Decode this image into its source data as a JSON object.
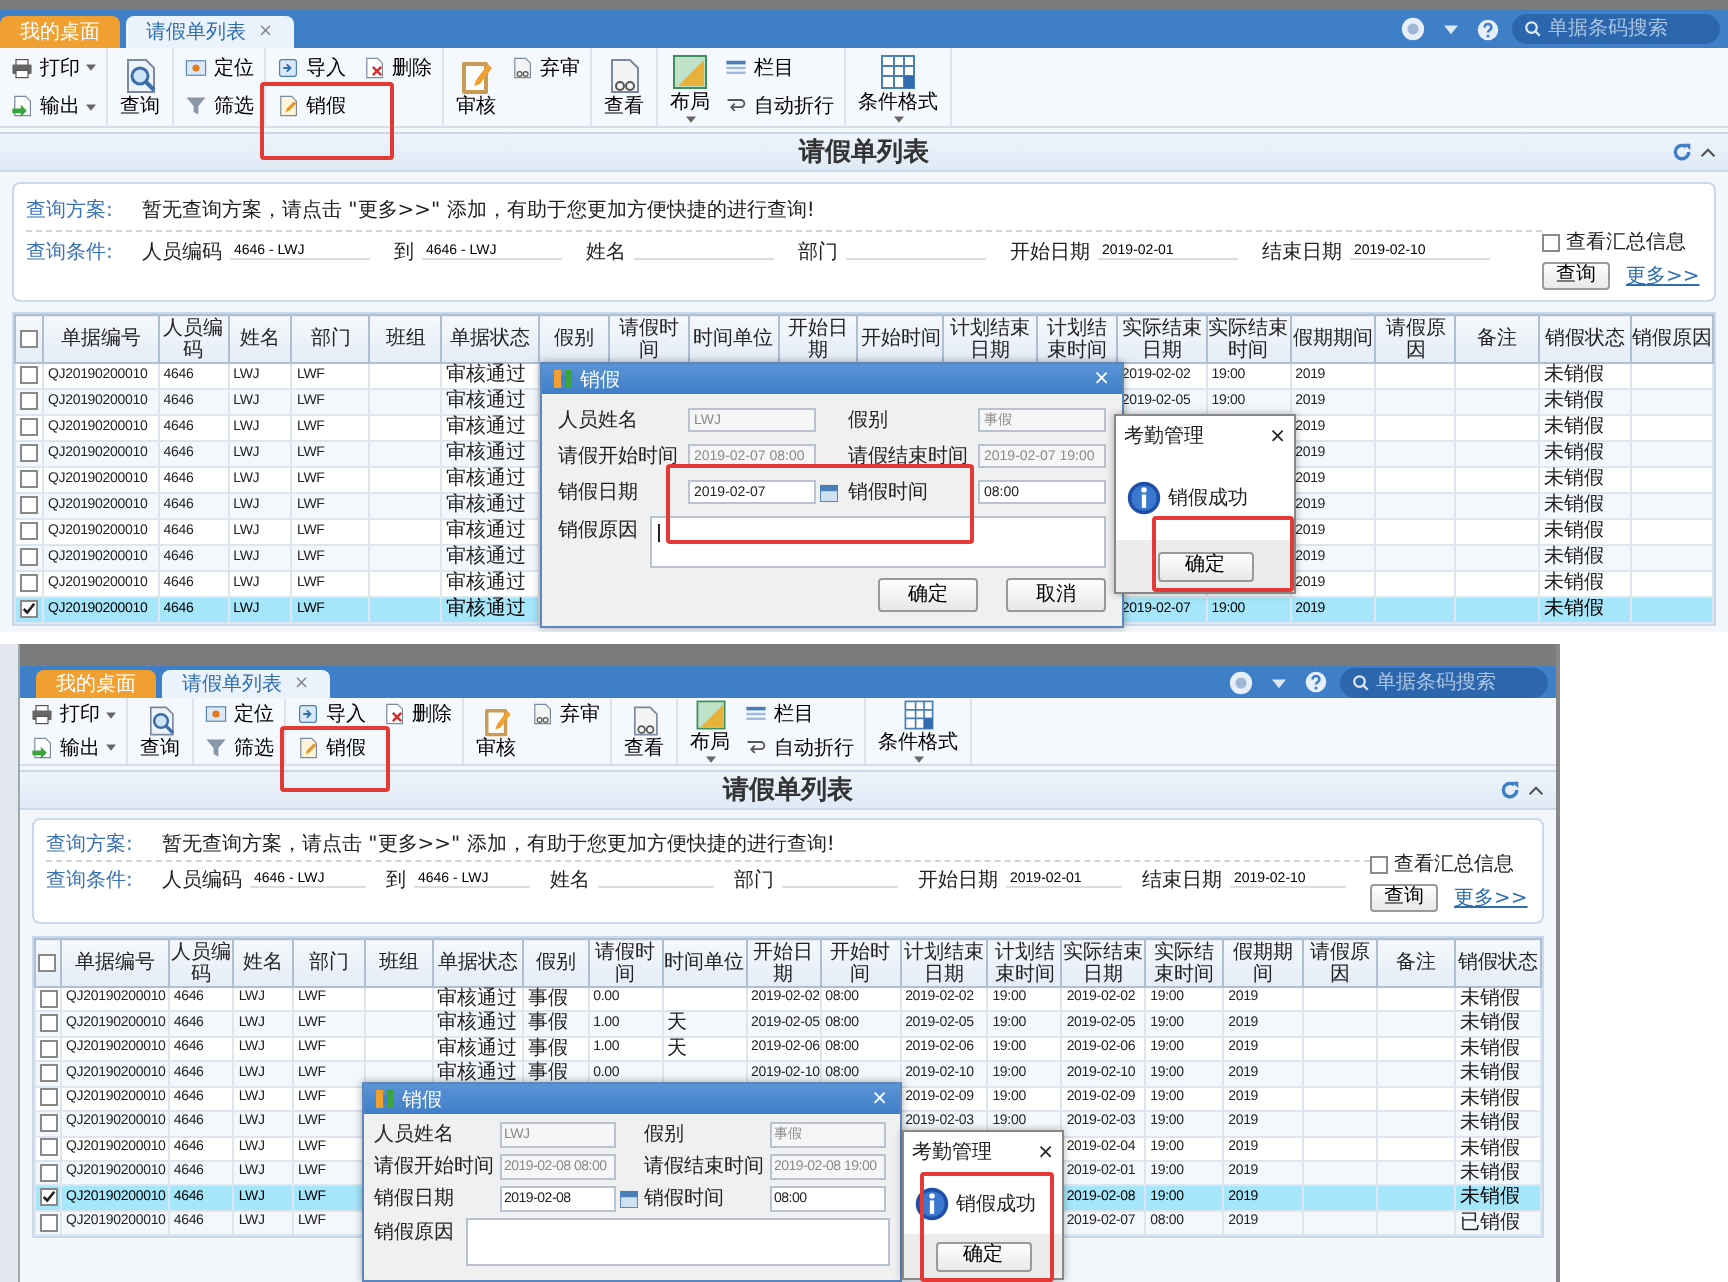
{
  "shots": [
    {
      "behind_window": false,
      "tabs": [
        {
          "label": "我的桌面",
          "kind": "home",
          "selected": false
        },
        {
          "label": "请假单列表",
          "kind": "page",
          "selected": true,
          "close": "×"
        }
      ],
      "search_placeholder": "单据条码搜索",
      "toolbar": [
        {
          "items": [
            {
              "label": "打印",
              "kind": "small",
              "dropdown": true,
              "highlighted": false
            },
            {
              "label": "输出",
              "kind": "small",
              "dropdown": true,
              "highlighted": false
            }
          ]
        },
        {
          "items": [
            {
              "label": "查询",
              "kind": "large",
              "highlighted": false
            }
          ]
        },
        {
          "items": [
            {
              "label": "定位",
              "kind": "small",
              "highlighted": false
            },
            {
              "label": "筛选",
              "kind": "small",
              "highlighted": false
            }
          ]
        },
        {
          "items": [
            {
              "label": "导入",
              "kind": "small",
              "highlighted": false
            },
            {
              "label": "销假",
              "kind": "small",
              "highlighted": true
            },
            {
              "label": "删除",
              "kind": "small",
              "highlighted": false
            }
          ]
        },
        {
          "items": [
            {
              "label": "审核",
              "kind": "large",
              "highlighted": false
            },
            {
              "label": "弃审",
              "kind": "small",
              "highlighted": false
            }
          ]
        },
        {
          "items": [
            {
              "label": "查看",
              "kind": "large",
              "highlighted": false
            }
          ]
        },
        {
          "items": [
            {
              "label": "布局",
              "kind": "large",
              "dropdown": true,
              "highlighted": false
            },
            {
              "label": "栏目",
              "kind": "small",
              "highlighted": false
            },
            {
              "label": "自动折行",
              "kind": "small",
              "highlighted": false
            }
          ]
        },
        {
          "items": [
            {
              "label": "条件格式",
              "kind": "large",
              "dropdown": true,
              "highlighted": false
            }
          ]
        }
      ],
      "page_title": "请假单列表",
      "query": {
        "scheme_label": "查询方案:",
        "scheme_text": "暂无查询方案，请点击 \"更多>>\" 添加，有助于您更加方便快捷的进行查询!",
        "condition_label": "查询条件:",
        "fields": [
          {
            "label": "人员编码",
            "value": "4646 - LWJ"
          },
          {
            "label": "到",
            "value": "4646 - LWJ"
          },
          {
            "label": "姓名"
          },
          {
            "label": "部门"
          },
          {
            "label": "开始日期",
            "value": "2019-02-01"
          },
          {
            "label": "结束日期",
            "value": "2019-02-10"
          }
        ],
        "summary": {
          "label": "查看汇总信息",
          "checked": false
        },
        "search_button": "查询",
        "more_link": "更多>>"
      },
      "table": {
        "header_checked": false,
        "columns": [
          "单据编号",
          "人员编码",
          "姓名",
          "部门",
          "班组",
          "单据状态",
          "假别",
          "请假时间",
          "时间单位",
          "开始日期",
          "开始时间",
          "计划结束日期",
          "计划结束时间",
          "实际结束日期",
          "实际结束时间",
          "假期期间",
          "请假原因",
          "备注",
          "销假状态",
          "销假原因"
        ],
        "rows": [
          {
            "checked": false,
            "selected": false,
            "cells": [
              "QJ20190200010",
              "4646",
              "LWJ",
              "LWF",
              null,
              "审核通过",
              null,
              null,
              null,
              null,
              null,
              null,
              null,
              "2019-02-02",
              "19:00",
              "2019",
              null,
              null,
              "未销假"
            ]
          },
          {
            "checked": false,
            "selected": false,
            "cells": [
              "QJ20190200010",
              "4646",
              "LWJ",
              "LWF",
              null,
              "审核通过",
              null,
              null,
              null,
              null,
              null,
              null,
              null,
              "2019-02-05",
              "19:00",
              "2019",
              null,
              null,
              "未销假"
            ]
          },
          {
            "checked": false,
            "selected": false,
            "cells": [
              "QJ20190200010",
              "4646",
              "LWJ",
              "LWF",
              null,
              "审核通过",
              null,
              null,
              null,
              null,
              null,
              null,
              null,
              null,
              null,
              "2019",
              null,
              null,
              "未销假"
            ]
          },
          {
            "checked": false,
            "selected": false,
            "cells": [
              "QJ20190200010",
              "4646",
              "LWJ",
              "LWF",
              null,
              "审核通过",
              null,
              null,
              null,
              null,
              null,
              null,
              null,
              null,
              null,
              "2019",
              null,
              null,
              "未销假"
            ]
          },
          {
            "checked": false,
            "selected": false,
            "cells": [
              "QJ20190200010",
              "4646",
              "LWJ",
              "LWF",
              null,
              "审核通过",
              null,
              null,
              null,
              null,
              null,
              null,
              null,
              null,
              null,
              "2019",
              null,
              null,
              "未销假"
            ]
          },
          {
            "checked": false,
            "selected": false,
            "cells": [
              "QJ20190200010",
              "4646",
              "LWJ",
              "LWF",
              null,
              "审核通过",
              null,
              null,
              null,
              null,
              null,
              null,
              null,
              null,
              null,
              "2019",
              null,
              null,
              "未销假"
            ]
          },
          {
            "checked": false,
            "selected": false,
            "cells": [
              "QJ20190200010",
              "4646",
              "LWJ",
              "LWF",
              null,
              "审核通过",
              null,
              null,
              null,
              null,
              null,
              null,
              null,
              null,
              null,
              "2019",
              null,
              null,
              "未销假"
            ]
          },
          {
            "checked": false,
            "selected": false,
            "cells": [
              "QJ20190200010",
              "4646",
              "LWJ",
              "LWF",
              null,
              "审核通过",
              null,
              null,
              null,
              null,
              null,
              null,
              null,
              null,
              null,
              "2019",
              null,
              null,
              "未销假"
            ]
          },
          {
            "checked": false,
            "selected": false,
            "cells": [
              "QJ20190200010",
              "4646",
              "LWJ",
              "LWF",
              null,
              "审核通过",
              null,
              null,
              null,
              null,
              null,
              null,
              null,
              null,
              null,
              "2019",
              null,
              null,
              "未销假"
            ]
          },
          {
            "checked": true,
            "selected": true,
            "cells": [
              "QJ20190200010",
              "4646",
              "LWJ",
              "LWF",
              null,
              "审核通过",
              null,
              null,
              null,
              null,
              null,
              null,
              null,
              "2019-02-07",
              "19:00",
              "2019",
              null,
              null,
              "未销假"
            ]
          }
        ]
      },
      "dialog": {
        "title": "销假",
        "close": "×",
        "fields": [
          {
            "label": "人员姓名",
            "value": "LWJ",
            "disabled": true
          },
          {
            "label": "假别",
            "value": "事假",
            "disabled": true
          },
          {
            "label": "请假开始时间",
            "value": "2019-02-07 08:00",
            "disabled": true
          },
          {
            "label": "请假结束时间",
            "value": "2019-02-07 19:00",
            "disabled": true
          },
          {
            "label": "销假日期",
            "value": "2019-02-07",
            "disabled": false,
            "kind": "date"
          },
          {
            "label": "销假时间",
            "value": "08:00",
            "disabled": false,
            "kind": "text"
          }
        ],
        "reason_label": "销假原因",
        "reason_focused": true,
        "fields_highlighted": true,
        "buttons": [
          "确定",
          "取消"
        ]
      },
      "message_box": {
        "title": "考勤管理",
        "close": "×",
        "message": "销假成功",
        "button": "确定",
        "button_highlighted": true,
        "body_highlighted": false
      }
    },
    {
      "behind_window": true,
      "tabs": [
        {
          "label": "我的桌面",
          "kind": "home",
          "selected": false
        },
        {
          "label": "请假单列表",
          "kind": "page",
          "selected": true,
          "close": "×"
        }
      ],
      "search_placeholder": "单据条码搜索",
      "toolbar": [
        {
          "items": [
            {
              "label": "打印",
              "kind": "small",
              "dropdown": true,
              "highlighted": false
            },
            {
              "label": "输出",
              "kind": "small",
              "dropdown": true,
              "highlighted": false
            }
          ]
        },
        {
          "items": [
            {
              "label": "查询",
              "kind": "large",
              "highlighted": false
            }
          ]
        },
        {
          "items": [
            {
              "label": "定位",
              "kind": "small",
              "highlighted": false
            },
            {
              "label": "筛选",
              "kind": "small",
              "highlighted": false
            }
          ]
        },
        {
          "items": [
            {
              "label": "导入",
              "kind": "small",
              "highlighted": false
            },
            {
              "label": "销假",
              "kind": "small",
              "highlighted": true
            },
            {
              "label": "删除",
              "kind": "small",
              "highlighted": false
            }
          ]
        },
        {
          "items": [
            {
              "label": "审核",
              "kind": "large",
              "highlighted": false
            },
            {
              "label": "弃审",
              "kind": "small",
              "highlighted": false
            }
          ]
        },
        {
          "items": [
            {
              "label": "查看",
              "kind": "large",
              "highlighted": false
            }
          ]
        },
        {
          "items": [
            {
              "label": "布局",
              "kind": "large",
              "dropdown": true,
              "highlighted": false
            },
            {
              "label": "栏目",
              "kind": "small",
              "highlighted": false
            },
            {
              "label": "自动折行",
              "kind": "small",
              "highlighted": false
            }
          ]
        },
        {
          "items": [
            {
              "label": "条件格式",
              "kind": "large",
              "dropdown": true,
              "highlighted": false
            }
          ]
        }
      ],
      "page_title": "请假单列表",
      "query": {
        "scheme_label": "查询方案:",
        "scheme_text": "暂无查询方案，请点击 \"更多>>\" 添加，有助于您更加方便快捷的进行查询!",
        "condition_label": "查询条件:",
        "fields": [
          {
            "label": "人员编码",
            "value": "4646 - LWJ"
          },
          {
            "label": "到",
            "value": "4646 - LWJ"
          },
          {
            "label": "姓名"
          },
          {
            "label": "部门"
          },
          {
            "label": "开始日期",
            "value": "2019-02-01"
          },
          {
            "label": "结束日期",
            "value": "2019-02-10"
          }
        ],
        "summary": {
          "label": "查看汇总信息",
          "checked": false
        },
        "search_button": "查询",
        "more_link": "更多>>"
      },
      "table": {
        "header_checked": false,
        "columns": [
          "单据编号",
          "人员编码",
          "姓名",
          "部门",
          "班组",
          "单据状态",
          "假别",
          "请假时间",
          "时间单位",
          "开始日期",
          "开始时间",
          "计划结束日期",
          "计划结束时间",
          "实际结束日期",
          "实际结束时间",
          "假期期间",
          "请假原因",
          "备注",
          "销假状态"
        ],
        "rows": [
          {
            "checked": false,
            "selected": false,
            "cells": [
              "QJ20190200010",
              "4646",
              "LWJ",
              "LWF",
              null,
              "审核通过",
              "事假",
              "0.00",
              null,
              "2019-02-02",
              "08:00",
              "2019-02-02",
              "19:00",
              "2019-02-02",
              "19:00",
              "2019",
              null,
              null,
              "未销假"
            ]
          },
          {
            "checked": false,
            "selected": false,
            "cells": [
              "QJ20190200010",
              "4646",
              "LWJ",
              "LWF",
              null,
              "审核通过",
              "事假",
              "1.00",
              "天",
              "2019-02-05",
              "08:00",
              "2019-02-05",
              "19:00",
              "2019-02-05",
              "19:00",
              "2019",
              null,
              null,
              "未销假"
            ]
          },
          {
            "checked": false,
            "selected": false,
            "cells": [
              "QJ20190200010",
              "4646",
              "LWJ",
              "LWF",
              null,
              "审核通过",
              "事假",
              "1.00",
              "天",
              "2019-02-06",
              "08:00",
              "2019-02-06",
              "19:00",
              "2019-02-06",
              "19:00",
              "2019",
              null,
              null,
              "未销假"
            ]
          },
          {
            "checked": false,
            "selected": false,
            "cells": [
              "QJ20190200010",
              "4646",
              "LWJ",
              "LWF",
              null,
              "审核通过",
              "事假",
              "0.00",
              null,
              "2019-02-10",
              "08:00",
              "2019-02-10",
              "19:00",
              "2019-02-10",
              "19:00",
              "2019",
              null,
              null,
              "未销假"
            ]
          },
          {
            "checked": false,
            "selected": false,
            "cells": [
              "QJ20190200010",
              "4646",
              "LWJ",
              "LWF",
              null,
              null,
              null,
              null,
              null,
              null,
              null,
              "2019-02-09",
              "19:00",
              "2019-02-09",
              "19:00",
              "2019",
              null,
              null,
              "未销假"
            ]
          },
          {
            "checked": false,
            "selected": false,
            "cells": [
              "QJ20190200010",
              "4646",
              "LWJ",
              "LWF",
              null,
              null,
              null,
              null,
              null,
              null,
              null,
              "2019-02-03",
              "19:00",
              "2019-02-03",
              "19:00",
              "2019",
              null,
              null,
              "未销假"
            ]
          },
          {
            "checked": false,
            "selected": false,
            "cells": [
              "QJ20190200010",
              "4646",
              "LWJ",
              "LWF",
              null,
              null,
              null,
              null,
              null,
              null,
              null,
              null,
              null,
              "2019-02-04",
              "19:00",
              "2019",
              null,
              null,
              "未销假"
            ]
          },
          {
            "checked": false,
            "selected": false,
            "cells": [
              "QJ20190200010",
              "4646",
              "LWJ",
              "LWF",
              null,
              null,
              null,
              null,
              null,
              null,
              null,
              null,
              null,
              "2019-02-01",
              "19:00",
              "2019",
              null,
              null,
              "未销假"
            ]
          },
          {
            "checked": true,
            "selected": true,
            "cells": [
              "QJ20190200010",
              "4646",
              "LWJ",
              "LWF",
              null,
              null,
              null,
              null,
              null,
              null,
              null,
              null,
              null,
              "2019-02-08",
              "19:00",
              "2019",
              null,
              null,
              "未销假"
            ]
          },
          {
            "checked": false,
            "selected": false,
            "cells": [
              "QJ20190200010",
              "4646",
              "LWJ",
              "LWF",
              null,
              null,
              null,
              null,
              null,
              null,
              null,
              null,
              null,
              "2019-02-07",
              "08:00",
              "2019",
              null,
              null,
              "已销假"
            ]
          }
        ]
      },
      "dialog": {
        "title": "销假",
        "close": "×",
        "fields": [
          {
            "label": "人员姓名",
            "value": "LWJ",
            "disabled": true
          },
          {
            "label": "假别",
            "value": "事假",
            "disabled": true
          },
          {
            "label": "请假开始时间",
            "value": "2019-02-08 08:00",
            "disabled": true
          },
          {
            "label": "请假结束时间",
            "value": "2019-02-08 19:00",
            "disabled": true
          },
          {
            "label": "销假日期",
            "value": "2019-02-08",
            "disabled": false,
            "kind": "date"
          },
          {
            "label": "销假时间",
            "value": "08:00",
            "disabled": false,
            "kind": "text"
          }
        ],
        "reason_label": "销假原因",
        "reason_focused": false,
        "fields_highlighted": false
      },
      "message_box": {
        "title": "考勤管理",
        "close": "×",
        "message": "销假成功",
        "button": "确定",
        "button_highlighted": false,
        "body_highlighted": true
      }
    }
  ]
}
